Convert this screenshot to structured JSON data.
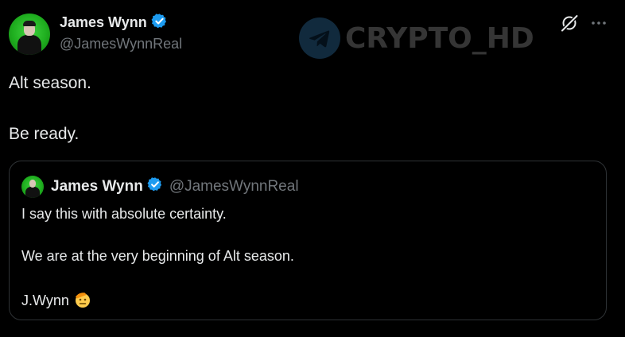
{
  "tweet": {
    "author_name": "James Wynn",
    "author_handle": "@JamesWynnReal",
    "lines": [
      "Alt season.",
      "Be ready."
    ]
  },
  "watermark": {
    "text": "CRYPTO_HD"
  },
  "quoted_tweet": {
    "author_name": "James Wynn",
    "author_handle": "@JamesWynnReal",
    "lines": [
      "I say this with absolute certainty.",
      "We are at the very beginning of Alt season.",
      "J.Wynn"
    ],
    "emoji_icon": "saluting-face-emoji"
  },
  "colors": {
    "background": "#000000",
    "text": "#e7e9ea",
    "secondary_text": "#71767b",
    "verified_badge": "#1d9bf0",
    "card_border": "#2f3336"
  }
}
